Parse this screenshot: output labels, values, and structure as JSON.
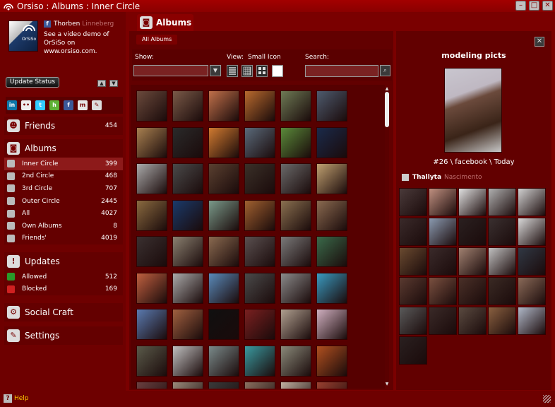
{
  "window": {
    "title": "Orsiso : Albums : Inner Circle",
    "controls": [
      "minimize",
      "maximize",
      "close"
    ]
  },
  "profile": {
    "first_name": "Thorben",
    "last_name": "Linneberg",
    "status": "See a video demo of OrSiSo on www.orsiso.com.",
    "avatar_label": "OrSiSo",
    "update_label": "Update Status"
  },
  "social_icons": [
    {
      "name": "linkedin-icon",
      "glyph": "in",
      "color": "#0e76a8"
    },
    {
      "name": "flickr-icon",
      "glyph": "••",
      "color": "#eeeeee"
    },
    {
      "name": "twitter-icon",
      "glyph": "t",
      "color": "#33ccff"
    },
    {
      "name": "hyves-icon",
      "glyph": "h",
      "color": "#5fb336"
    },
    {
      "name": "facebook-icon",
      "glyph": "f",
      "color": "#3b5998"
    },
    {
      "name": "myspace-icon",
      "glyph": "m",
      "color": "#e7e7e7"
    },
    {
      "name": "settings-wrench-icon",
      "glyph": "✎",
      "color": "#dddddd"
    }
  ],
  "nav": {
    "friends": {
      "label": "Friends",
      "count": "454"
    },
    "albums": {
      "label": "Albums",
      "items": [
        {
          "label": "Inner Circle",
          "count": "399"
        },
        {
          "label": "2nd Circle",
          "count": "468"
        },
        {
          "label": "3rd Circle",
          "count": "707"
        },
        {
          "label": "Outer Circle",
          "count": "2445"
        },
        {
          "label": "All",
          "count": "4027"
        },
        {
          "label": "Own Albums",
          "count": "8"
        },
        {
          "label": "Friends'",
          "count": "4019"
        }
      ]
    },
    "updates": {
      "label": "Updates",
      "items": [
        {
          "label": "Allowed",
          "count": "512"
        },
        {
          "label": "Blocked",
          "count": "169"
        }
      ]
    },
    "social_craft": {
      "label": "Social Craft"
    },
    "settings": {
      "label": "Settings"
    }
  },
  "main": {
    "tab_label": "Albums",
    "breadcrumb": "All Albums",
    "show_label": "Show:",
    "view_label": "View:",
    "view_value": "Small Icon",
    "search_label": "Search:",
    "view_modes": [
      "list-view",
      "small-grid-view",
      "medium-grid-view",
      "large-view"
    ],
    "thumbnails": [
      "#6b4a3c",
      "#7a5a48",
      "#c0704a",
      "#b86a2e",
      "#6e7a55",
      "#4e5b6e",
      "#a88050",
      "#2a2a2a",
      "#d07a30",
      "#5a6a7a",
      "#5a8a3a",
      "#1a2a4a",
      "#aaaaaa",
      "#4a4a4a",
      "#5a4030",
      "#3a3028",
      "#6a6a6a",
      "#c0a070",
      "#8a6a40",
      "#1a3a6a",
      "#7a9a8a",
      "#a06030",
      "#8a7050",
      "#8a6a50",
      "#3a3030",
      "#8a8070",
      "#8a6a50",
      "#5a5050",
      "#7a7a7a",
      "#3a6a4a",
      "#c06040",
      "#aaaaaa",
      "#5a8aba",
      "#4a4a4a",
      "#8a8a8a",
      "#3a9ac0",
      "#5a7ab0",
      "#a06040",
      "#101010",
      "#7a2020",
      "#b0a090",
      "#d0b0c0",
      "#5a5a4a",
      "#c0c0c0",
      "#7a8a8a",
      "#3a9aa0",
      "#8a8a7a",
      "#b05020",
      "#6a4040",
      "#9a8a7a",
      "#3a3a3a",
      "#8a7060",
      "#c0b0a0",
      "#9a4030"
    ]
  },
  "detail": {
    "album_title": "modeling picts",
    "meta": "#26 \\ facebook \\ Today",
    "owner_first": "Thallyta",
    "owner_last": "Nascimento",
    "photos": [
      "#4a3a3a",
      "#c09080",
      "#e0e0e0",
      "#b0b0b0",
      "#d0d0d0",
      "#3a2a2a",
      "#8a9ab0",
      "#2a2020",
      "#3a3030",
      "#d8d8d8",
      "#6a4a30",
      "#3a2a2a",
      "#a08070",
      "#c0c0c0",
      "#303844",
      "#5a3a30",
      "#7a5040",
      "#4a3028",
      "#3a2a24",
      "#8a6a58",
      "#5a5a5a",
      "#3a2a28",
      "#5a4a40",
      "#8a6040",
      "#b0b8c8",
      "#2a2020"
    ]
  },
  "footer": {
    "help_label": "Help"
  }
}
